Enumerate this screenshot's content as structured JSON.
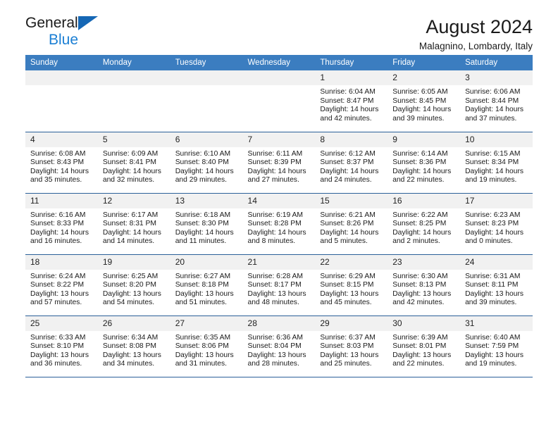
{
  "brand": {
    "name_part1": "General",
    "name_part2": "Blue",
    "triangle_icon": "triangle-logo-icon"
  },
  "header": {
    "title": "August 2024",
    "subtitle": "Malagnino, Lombardy, Italy"
  },
  "calendar": {
    "weekday_headers": [
      "Sunday",
      "Monday",
      "Tuesday",
      "Wednesday",
      "Thursday",
      "Friday",
      "Saturday"
    ],
    "accent_color": "#3b7dc0",
    "daynum_bg": "#f1f1f1",
    "weeks": [
      [
        {
          "day": "",
          "empty": true,
          "sunrise": "",
          "sunset": "",
          "daylight_line1": "",
          "daylight_line2": ""
        },
        {
          "day": "",
          "empty": true,
          "sunrise": "",
          "sunset": "",
          "daylight_line1": "",
          "daylight_line2": ""
        },
        {
          "day": "",
          "empty": true,
          "sunrise": "",
          "sunset": "",
          "daylight_line1": "",
          "daylight_line2": ""
        },
        {
          "day": "",
          "empty": true,
          "sunrise": "",
          "sunset": "",
          "daylight_line1": "",
          "daylight_line2": ""
        },
        {
          "day": "1",
          "empty": false,
          "sunrise": "Sunrise: 6:04 AM",
          "sunset": "Sunset: 8:47 PM",
          "daylight_line1": "Daylight: 14 hours",
          "daylight_line2": "and 42 minutes."
        },
        {
          "day": "2",
          "empty": false,
          "sunrise": "Sunrise: 6:05 AM",
          "sunset": "Sunset: 8:45 PM",
          "daylight_line1": "Daylight: 14 hours",
          "daylight_line2": "and 39 minutes."
        },
        {
          "day": "3",
          "empty": false,
          "sunrise": "Sunrise: 6:06 AM",
          "sunset": "Sunset: 8:44 PM",
          "daylight_line1": "Daylight: 14 hours",
          "daylight_line2": "and 37 minutes."
        }
      ],
      [
        {
          "day": "4",
          "empty": false,
          "sunrise": "Sunrise: 6:08 AM",
          "sunset": "Sunset: 8:43 PM",
          "daylight_line1": "Daylight: 14 hours",
          "daylight_line2": "and 35 minutes."
        },
        {
          "day": "5",
          "empty": false,
          "sunrise": "Sunrise: 6:09 AM",
          "sunset": "Sunset: 8:41 PM",
          "daylight_line1": "Daylight: 14 hours",
          "daylight_line2": "and 32 minutes."
        },
        {
          "day": "6",
          "empty": false,
          "sunrise": "Sunrise: 6:10 AM",
          "sunset": "Sunset: 8:40 PM",
          "daylight_line1": "Daylight: 14 hours",
          "daylight_line2": "and 29 minutes."
        },
        {
          "day": "7",
          "empty": false,
          "sunrise": "Sunrise: 6:11 AM",
          "sunset": "Sunset: 8:39 PM",
          "daylight_line1": "Daylight: 14 hours",
          "daylight_line2": "and 27 minutes."
        },
        {
          "day": "8",
          "empty": false,
          "sunrise": "Sunrise: 6:12 AM",
          "sunset": "Sunset: 8:37 PM",
          "daylight_line1": "Daylight: 14 hours",
          "daylight_line2": "and 24 minutes."
        },
        {
          "day": "9",
          "empty": false,
          "sunrise": "Sunrise: 6:14 AM",
          "sunset": "Sunset: 8:36 PM",
          "daylight_line1": "Daylight: 14 hours",
          "daylight_line2": "and 22 minutes."
        },
        {
          "day": "10",
          "empty": false,
          "sunrise": "Sunrise: 6:15 AM",
          "sunset": "Sunset: 8:34 PM",
          "daylight_line1": "Daylight: 14 hours",
          "daylight_line2": "and 19 minutes."
        }
      ],
      [
        {
          "day": "11",
          "empty": false,
          "sunrise": "Sunrise: 6:16 AM",
          "sunset": "Sunset: 8:33 PM",
          "daylight_line1": "Daylight: 14 hours",
          "daylight_line2": "and 16 minutes."
        },
        {
          "day": "12",
          "empty": false,
          "sunrise": "Sunrise: 6:17 AM",
          "sunset": "Sunset: 8:31 PM",
          "daylight_line1": "Daylight: 14 hours",
          "daylight_line2": "and 14 minutes."
        },
        {
          "day": "13",
          "empty": false,
          "sunrise": "Sunrise: 6:18 AM",
          "sunset": "Sunset: 8:30 PM",
          "daylight_line1": "Daylight: 14 hours",
          "daylight_line2": "and 11 minutes."
        },
        {
          "day": "14",
          "empty": false,
          "sunrise": "Sunrise: 6:19 AM",
          "sunset": "Sunset: 8:28 PM",
          "daylight_line1": "Daylight: 14 hours",
          "daylight_line2": "and 8 minutes."
        },
        {
          "day": "15",
          "empty": false,
          "sunrise": "Sunrise: 6:21 AM",
          "sunset": "Sunset: 8:26 PM",
          "daylight_line1": "Daylight: 14 hours",
          "daylight_line2": "and 5 minutes."
        },
        {
          "day": "16",
          "empty": false,
          "sunrise": "Sunrise: 6:22 AM",
          "sunset": "Sunset: 8:25 PM",
          "daylight_line1": "Daylight: 14 hours",
          "daylight_line2": "and 2 minutes."
        },
        {
          "day": "17",
          "empty": false,
          "sunrise": "Sunrise: 6:23 AM",
          "sunset": "Sunset: 8:23 PM",
          "daylight_line1": "Daylight: 14 hours",
          "daylight_line2": "and 0 minutes."
        }
      ],
      [
        {
          "day": "18",
          "empty": false,
          "sunrise": "Sunrise: 6:24 AM",
          "sunset": "Sunset: 8:22 PM",
          "daylight_line1": "Daylight: 13 hours",
          "daylight_line2": "and 57 minutes."
        },
        {
          "day": "19",
          "empty": false,
          "sunrise": "Sunrise: 6:25 AM",
          "sunset": "Sunset: 8:20 PM",
          "daylight_line1": "Daylight: 13 hours",
          "daylight_line2": "and 54 minutes."
        },
        {
          "day": "20",
          "empty": false,
          "sunrise": "Sunrise: 6:27 AM",
          "sunset": "Sunset: 8:18 PM",
          "daylight_line1": "Daylight: 13 hours",
          "daylight_line2": "and 51 minutes."
        },
        {
          "day": "21",
          "empty": false,
          "sunrise": "Sunrise: 6:28 AM",
          "sunset": "Sunset: 8:17 PM",
          "daylight_line1": "Daylight: 13 hours",
          "daylight_line2": "and 48 minutes."
        },
        {
          "day": "22",
          "empty": false,
          "sunrise": "Sunrise: 6:29 AM",
          "sunset": "Sunset: 8:15 PM",
          "daylight_line1": "Daylight: 13 hours",
          "daylight_line2": "and 45 minutes."
        },
        {
          "day": "23",
          "empty": false,
          "sunrise": "Sunrise: 6:30 AM",
          "sunset": "Sunset: 8:13 PM",
          "daylight_line1": "Daylight: 13 hours",
          "daylight_line2": "and 42 minutes."
        },
        {
          "day": "24",
          "empty": false,
          "sunrise": "Sunrise: 6:31 AM",
          "sunset": "Sunset: 8:11 PM",
          "daylight_line1": "Daylight: 13 hours",
          "daylight_line2": "and 39 minutes."
        }
      ],
      [
        {
          "day": "25",
          "empty": false,
          "sunrise": "Sunrise: 6:33 AM",
          "sunset": "Sunset: 8:10 PM",
          "daylight_line1": "Daylight: 13 hours",
          "daylight_line2": "and 36 minutes."
        },
        {
          "day": "26",
          "empty": false,
          "sunrise": "Sunrise: 6:34 AM",
          "sunset": "Sunset: 8:08 PM",
          "daylight_line1": "Daylight: 13 hours",
          "daylight_line2": "and 34 minutes."
        },
        {
          "day": "27",
          "empty": false,
          "sunrise": "Sunrise: 6:35 AM",
          "sunset": "Sunset: 8:06 PM",
          "daylight_line1": "Daylight: 13 hours",
          "daylight_line2": "and 31 minutes."
        },
        {
          "day": "28",
          "empty": false,
          "sunrise": "Sunrise: 6:36 AM",
          "sunset": "Sunset: 8:04 PM",
          "daylight_line1": "Daylight: 13 hours",
          "daylight_line2": "and 28 minutes."
        },
        {
          "day": "29",
          "empty": false,
          "sunrise": "Sunrise: 6:37 AM",
          "sunset": "Sunset: 8:03 PM",
          "daylight_line1": "Daylight: 13 hours",
          "daylight_line2": "and 25 minutes."
        },
        {
          "day": "30",
          "empty": false,
          "sunrise": "Sunrise: 6:39 AM",
          "sunset": "Sunset: 8:01 PM",
          "daylight_line1": "Daylight: 13 hours",
          "daylight_line2": "and 22 minutes."
        },
        {
          "day": "31",
          "empty": false,
          "sunrise": "Sunrise: 6:40 AM",
          "sunset": "Sunset: 7:59 PM",
          "daylight_line1": "Daylight: 13 hours",
          "daylight_line2": "and 19 minutes."
        }
      ]
    ]
  }
}
